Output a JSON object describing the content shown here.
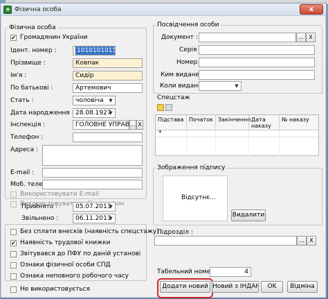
{
  "window": {
    "title": "Фізична особа",
    "close_label": "x"
  },
  "person": {
    "legend": "Фізична особа",
    "citizen_label": "Громадянин України",
    "citizen_checked": true,
    "id_label": "Ідент. номер :",
    "id_value": "1010101015",
    "surname_label": "Прізвище :",
    "surname_value": "Ковпак",
    "name_label": "Ім'я :",
    "name_value": "Сидір",
    "patronymic_label": "По батькові :",
    "patronymic_value": "Артемович",
    "sex_label": "Стать :",
    "sex_value": "чоловіча",
    "dob_label": "Дата народження :",
    "dob_value": "28.08.1927",
    "inspection_label": "Інспекція :",
    "inspection_value": "ГОЛОВНЕ УПРАВЛІ",
    "phone_label": "Телефон :",
    "address_label": "Адреса :",
    "email_label": "E-mail :",
    "mobile_label": "Моб. телефон :",
    "use_email_label": "Використовувати E-mail",
    "use_mobile_label": "Використовувати моб. телефон"
  },
  "employment": {
    "hired_label": "Прийнято :",
    "hired_value": "05.07.2013",
    "fired_label": "Звільнено :",
    "fired_value": "06.11.2013"
  },
  "flags": {
    "items": [
      {
        "label": "Без сплати внесків (наявність спецстажу)",
        "checked": false
      },
      {
        "label": "Наявність трудової книжки",
        "checked": true
      },
      {
        "label": "Звітувався до ПФУ по даній установі",
        "checked": false
      },
      {
        "label": "Ознаки фізичної особи СПД",
        "checked": false
      },
      {
        "label": "Ознака неповного робочого часу",
        "checked": false
      }
    ],
    "unused_label": "Не використовується"
  },
  "id_doc": {
    "legend": "Посвідчення особи",
    "document_label": "Документ :",
    "series_label": "Серія :",
    "number_label": "Номер :",
    "issued_by_label": "Ким видане :",
    "issued_when_label": "Коли видане :"
  },
  "special_exp": {
    "legend": "Спецстаж",
    "columns": [
      "Підстава",
      "Початок",
      "Закінчення",
      "Дата наказу",
      "№ наказу"
    ],
    "row_marker": "*"
  },
  "signature": {
    "legend": "Зображення підпису",
    "placeholder": "Відсутнє...",
    "delete_label": "Видалити"
  },
  "subdivision": {
    "label": "Підрозділ :"
  },
  "tab_number": {
    "label": "Табельний номер :",
    "value": "4"
  },
  "buttons": {
    "add_new": "Додати новий",
    "copy_data": "Новий з ІНДАНІ",
    "ok": "OK",
    "cancel": "Відміна"
  },
  "common": {
    "ellipsis": "...",
    "clear": "X",
    "dropdown": "▼",
    "check": "✔"
  }
}
